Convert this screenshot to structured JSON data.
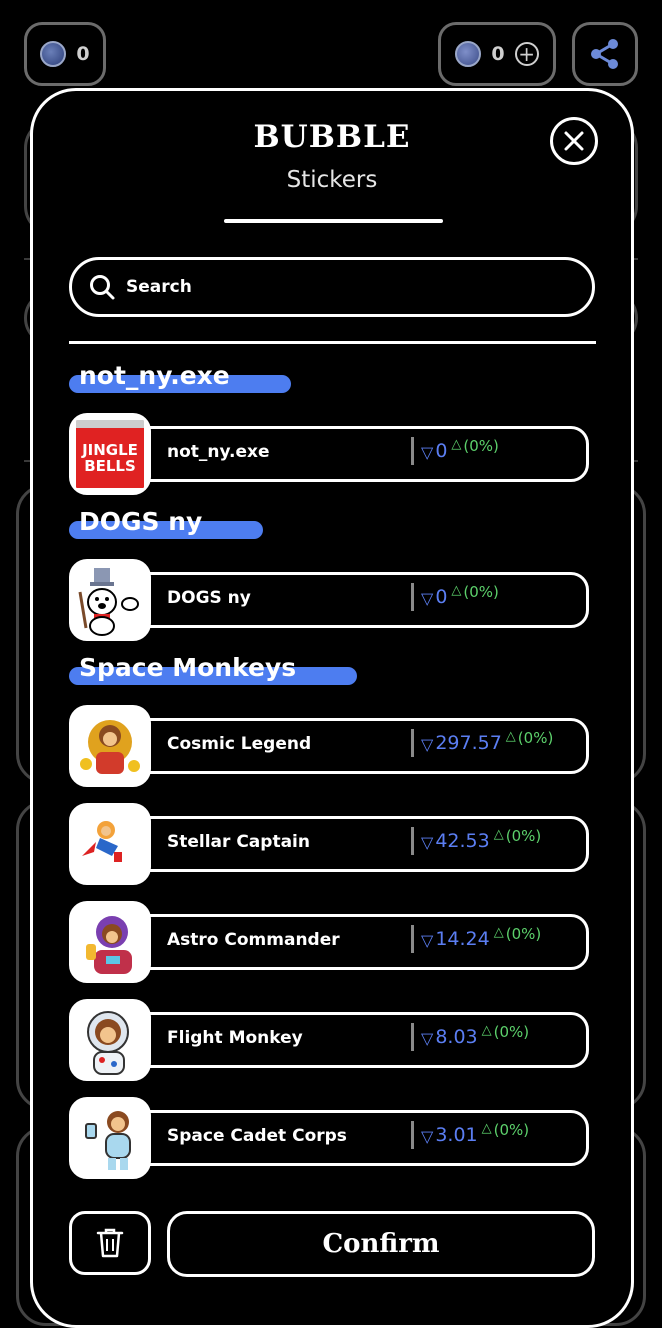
{
  "top_bar": {
    "bubbles_count": "0",
    "ton_count": "0"
  },
  "modal": {
    "title": "BUBBLE",
    "subtitle": "Stickers",
    "search_placeholder": "Search",
    "confirm_label": "Confirm"
  },
  "sections": [
    {
      "title": "not_ny.exe",
      "items": [
        {
          "name": "not_ny.exe",
          "price": "0",
          "change": "(0%)",
          "thumb_text": "JINGLE BELLS"
        }
      ]
    },
    {
      "title": "DOGS ny",
      "items": [
        {
          "name": "DOGS ny",
          "price": "0",
          "change": "(0%)"
        }
      ]
    },
    {
      "title": "Space Monkeys",
      "items": [
        {
          "name": "Cosmic Legend",
          "price": "297.57",
          "change": "(0%)"
        },
        {
          "name": "Stellar Captain",
          "price": "42.53",
          "change": "(0%)"
        },
        {
          "name": "Astro Commander",
          "price": "14.24",
          "change": "(0%)"
        },
        {
          "name": "Flight Monkey",
          "price": "8.03",
          "change": "(0%)"
        },
        {
          "name": "Space Cadet Corps",
          "price": "3.01",
          "change": "(0%)"
        }
      ]
    }
  ],
  "colors": {
    "accent_blue": "#4d7df0",
    "price_blue": "#5b7ef2",
    "change_green": "#5cd06b"
  }
}
